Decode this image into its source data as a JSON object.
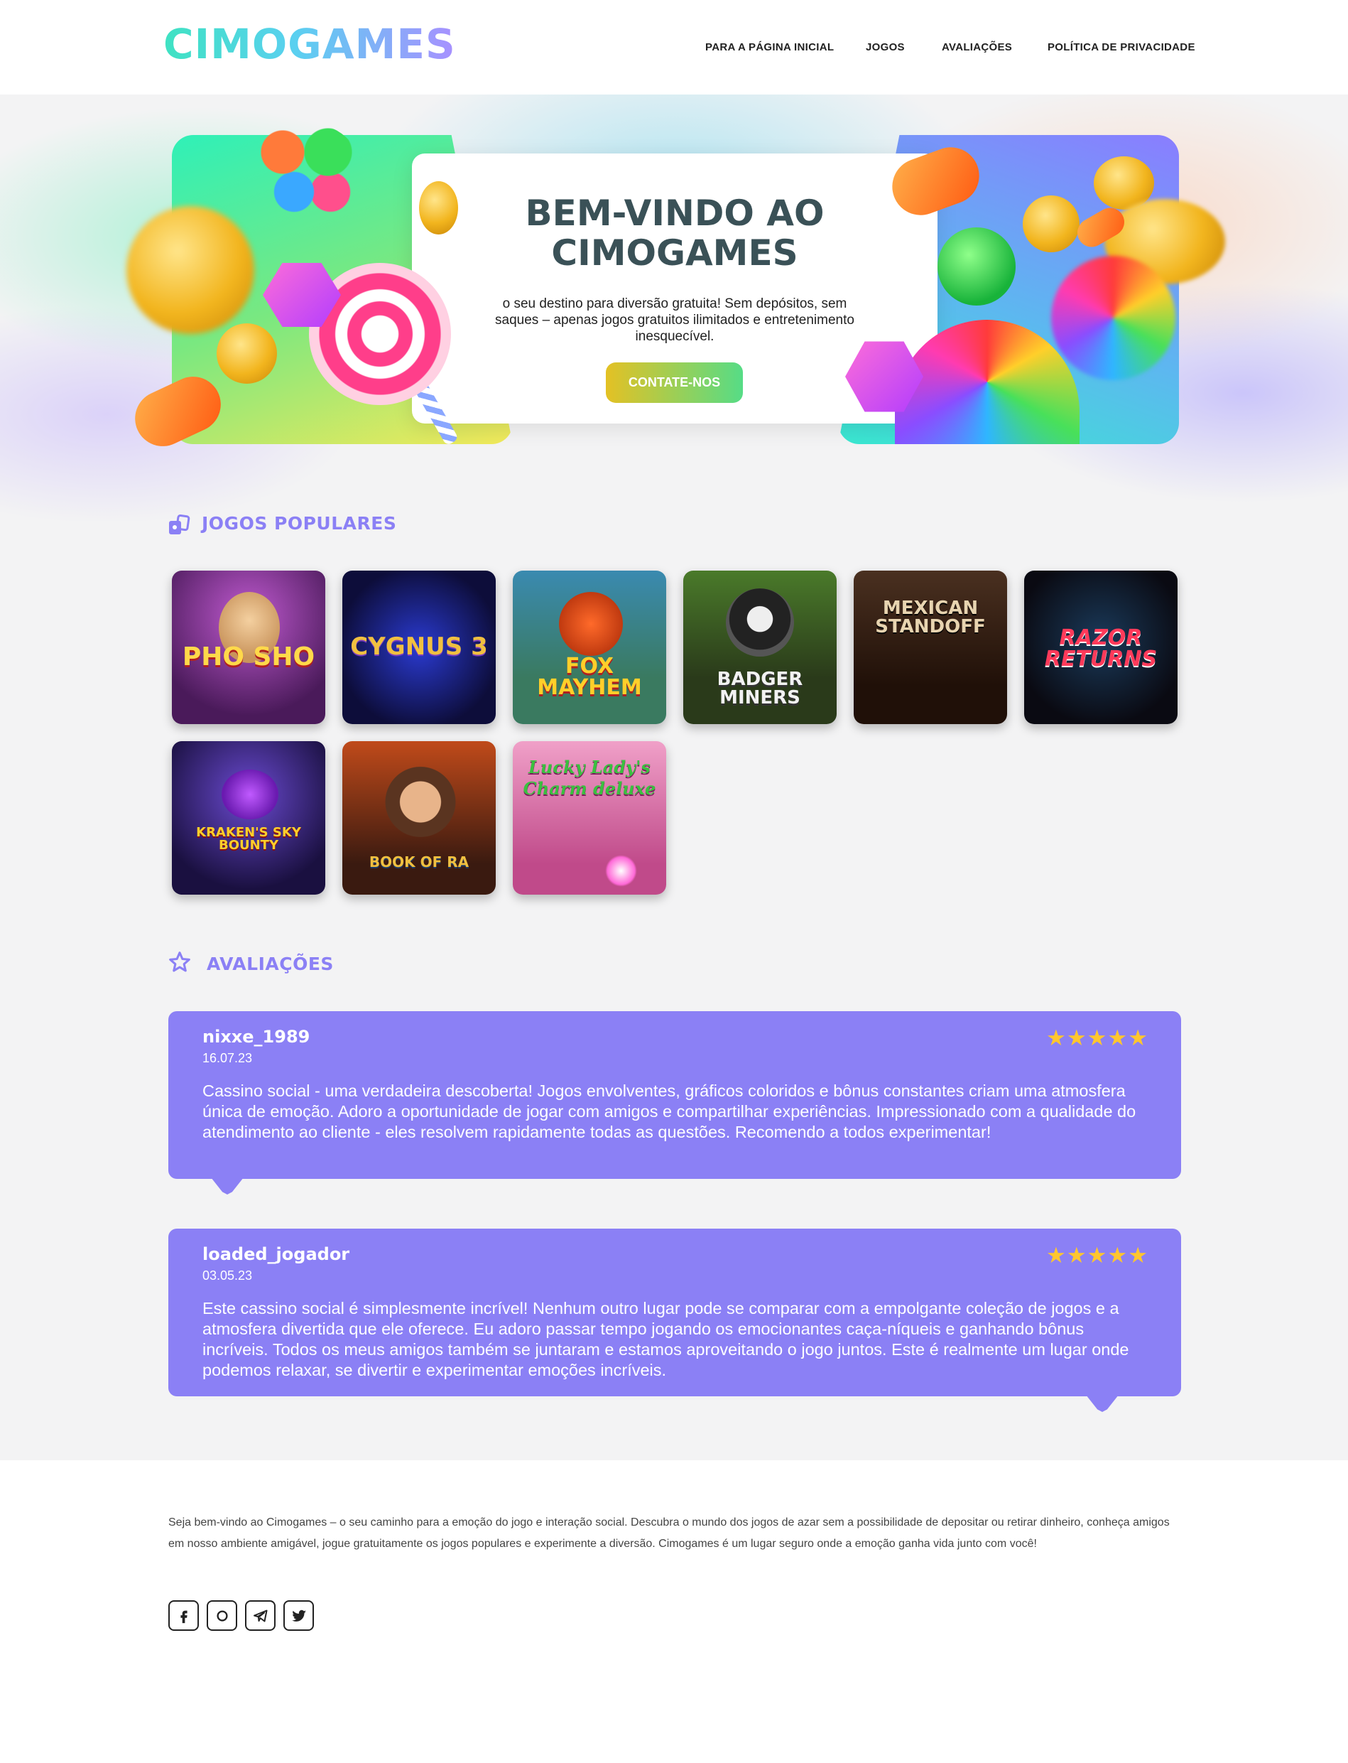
{
  "header": {
    "logo": "CIMOGAMES",
    "nav": [
      "PARA A PÁGINA INICIAL",
      "JOGOS",
      "AVALIAÇÕES",
      "POLÍTICA DE PRIVACIDADE"
    ]
  },
  "hero": {
    "title": "BEM-VINDO AO CIMOGAMES",
    "subtitle": "o seu destino para diversão gratuita! Sem depósitos, sem saques – apenas jogos gratuitos ilimitados e entretenimento inesquecível.",
    "button": "CONTATE-NOS"
  },
  "games_section": {
    "title": "JOGOS POPULARES",
    "icon": "cards-icon",
    "games": [
      "PHO SHO",
      "CYGNUS 3",
      "FOX MAYHEM",
      "BADGER MINERS",
      "MEXICAN STANDOFF",
      "RAZOR RETURNS",
      "KRAKEN'S SKY BOUNTY",
      "BOOK OF RA",
      "Lucky Lady's Charm deluxe"
    ]
  },
  "reviews_section": {
    "title": "AVALIAÇÕES",
    "icon": "star-outline-icon",
    "reviews": [
      {
        "name": "nixxe_1989",
        "date": "16.07.23",
        "rating": 5,
        "text": "Cassino social - uma verdadeira descoberta! Jogos envolventes, gráficos coloridos e bônus constantes criam uma atmosfera única de emoção. Adoro a oportunidade de jogar com amigos e compartilhar experiências. Impressionado com a qualidade do atendimento ao cliente - eles resolvem rapidamente todas as questões. Recomendo a todos experimentar!"
      },
      {
        "name": "loaded_jogador",
        "date": "03.05.23",
        "rating": 5,
        "text": "Este cassino social é simplesmente incrível! Nenhum outro lugar pode se comparar com a empolgante coleção de jogos e a atmosfera divertida que ele oferece. Eu adoro passar tempo jogando os emocionantes caça-níqueis e ganhando bônus incríveis. Todos os meus amigos também se juntaram e estamos aproveitando o jogo juntos. Este é realmente um lugar onde podemos relaxar, se divertir e experimentar emoções incríveis."
      }
    ]
  },
  "footer": {
    "text": "Seja bem-vindo ao Cimogames – o seu caminho para a emoção do jogo e interação social. Descubra o mundo dos jogos de azar sem a possibilidade de depositar ou retirar dinheiro, conheça amigos em nosso ambiente amigável, jogue gratuitamente os jogos populares e experimente a diversão. Cimogames é um lugar seguro onde a emoção ganha vida junto com você!",
    "social": [
      "facebook-icon",
      "instagram-icon",
      "telegram-icon",
      "twitter-icon"
    ]
  },
  "colors": {
    "accent": "#8b80f5",
    "heading": "#3a5157",
    "star": "#ffc62e"
  }
}
